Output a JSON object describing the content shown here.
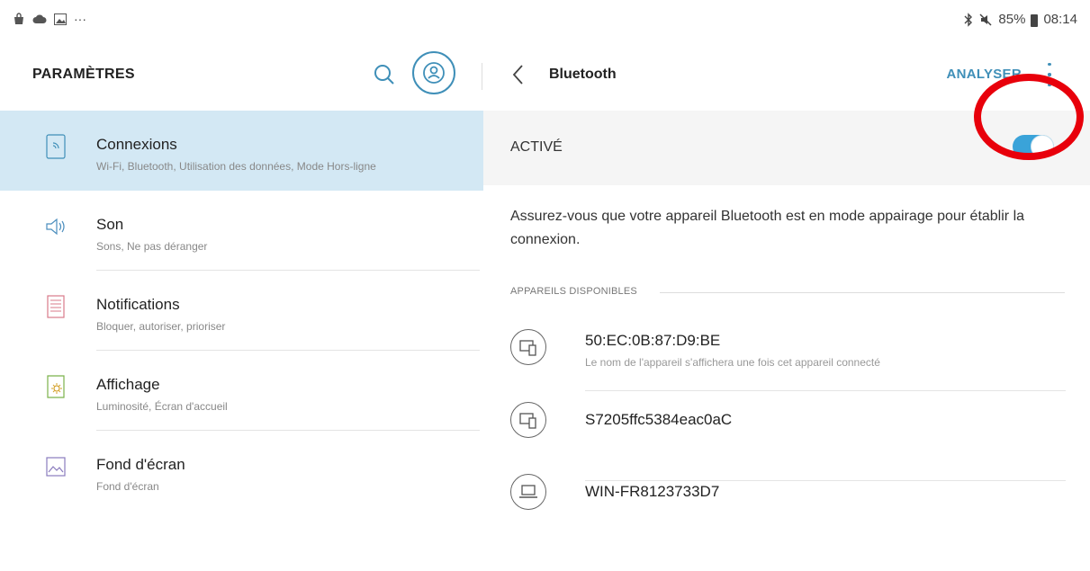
{
  "status_bar": {
    "more": "···",
    "battery": "85%",
    "time": "08:14"
  },
  "settings": {
    "title": "PARAMÈTRES",
    "items": [
      {
        "title": "Connexions",
        "subtitle": "Wi-Fi, Bluetooth, Utilisation des données, Mode Hors-ligne",
        "icon": "wifi-icon",
        "active": true
      },
      {
        "title": "Son",
        "subtitle": "Sons, Ne pas déranger",
        "icon": "speaker-icon",
        "active": false
      },
      {
        "title": "Notifications",
        "subtitle": "Bloquer, autoriser, prioriser",
        "icon": "notification-icon",
        "active": false
      },
      {
        "title": "Affichage",
        "subtitle": "Luminosité, Écran d'accueil",
        "icon": "display-icon",
        "active": false
      },
      {
        "title": "Fond d'écran",
        "subtitle": "Fond d'écran",
        "icon": "wallpaper-icon",
        "active": false
      }
    ]
  },
  "bluetooth": {
    "title": "Bluetooth",
    "scan_label": "ANALYSER",
    "toggle_label": "ACTIVÉ",
    "toggle_on": true,
    "info": "Assurez-vous que votre appareil Bluetooth est en mode appairage pour établir la connexion.",
    "available_header": "APPAREILS DISPONIBLES",
    "devices": [
      {
        "name": "50:EC:0B:87:D9:BE",
        "subtitle": "Le nom de l'appareil s'affichera une fois cet appareil connecté",
        "icon": "device-icon"
      },
      {
        "name": "S7205ffc5384eac0aC",
        "subtitle": "",
        "icon": "device-icon"
      },
      {
        "name": "WIN-FR8123733D7",
        "subtitle": "",
        "icon": "laptop-icon"
      }
    ]
  },
  "colors": {
    "accent": "#3f8fb8",
    "toggle": "#3aa3d9",
    "selected_row": "#d3e8f4",
    "annotation": "#e8000b"
  }
}
